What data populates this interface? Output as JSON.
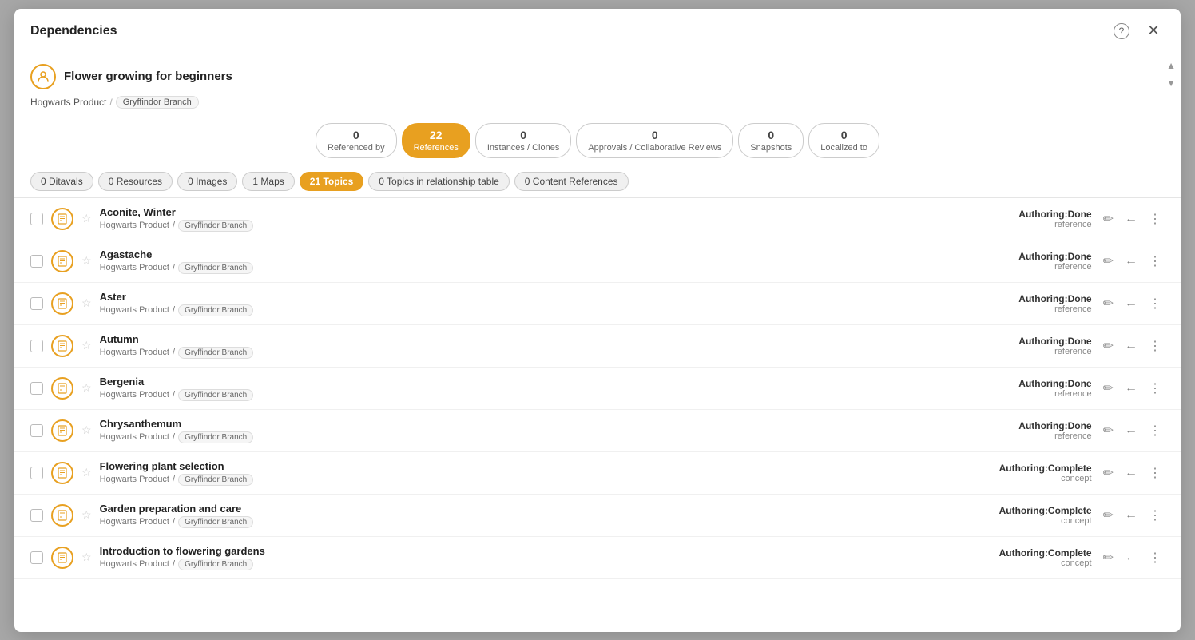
{
  "modal": {
    "title": "Dependencies",
    "close_label": "×",
    "help_icon": "?"
  },
  "item": {
    "name": "Flower growing for beginners",
    "icon": "person",
    "breadcrumb_product": "Hogwarts Product",
    "breadcrumb_sep": "/",
    "breadcrumb_branch": "Gryffindor Branch"
  },
  "tabs": [
    {
      "count": "0",
      "label": "Referenced by"
    },
    {
      "count": "22",
      "label": "References",
      "active": true
    },
    {
      "count": "0",
      "label": "Instances / Clones"
    },
    {
      "count": "0",
      "label": "Approvals / Collaborative Reviews"
    },
    {
      "count": "0",
      "label": "Snapshots"
    },
    {
      "count": "0",
      "label": "Localized to"
    }
  ],
  "chips": [
    {
      "label": "0 Ditavals"
    },
    {
      "label": "0 Resources"
    },
    {
      "label": "0 Images"
    },
    {
      "label": "1 Maps"
    },
    {
      "label": "21 Topics",
      "active": true
    },
    {
      "label": "0 Topics in relationship table"
    },
    {
      "label": "0 Content References"
    }
  ],
  "list_items": [
    {
      "title": "Aconite, Winter",
      "product": "Hogwarts Product",
      "branch": "Gryffindor Branch",
      "status": "Authoring:Done",
      "type": "reference"
    },
    {
      "title": "Agastache",
      "product": "Hogwarts Product",
      "branch": "Gryffindor Branch",
      "status": "Authoring:Done",
      "type": "reference"
    },
    {
      "title": "Aster",
      "product": "Hogwarts Product",
      "branch": "Gryffindor Branch",
      "status": "Authoring:Done",
      "type": "reference"
    },
    {
      "title": "Autumn",
      "product": "Hogwarts Product",
      "branch": "Gryffindor Branch",
      "status": "Authoring:Done",
      "type": "reference"
    },
    {
      "title": "Bergenia",
      "product": "Hogwarts Product",
      "branch": "Gryffindor Branch",
      "status": "Authoring:Done",
      "type": "reference"
    },
    {
      "title": "Chrysanthemum",
      "product": "Hogwarts Product",
      "branch": "Gryffindor Branch",
      "status": "Authoring:Done",
      "type": "reference"
    },
    {
      "title": "Flowering plant selection",
      "product": "Hogwarts Product",
      "branch": "Gryffindor Branch",
      "status": "Authoring:Complete",
      "type": "concept"
    },
    {
      "title": "Garden preparation and care",
      "product": "Hogwarts Product",
      "branch": "Gryffindor Branch",
      "status": "Authoring:Complete",
      "type": "concept"
    },
    {
      "title": "Introduction to flowering gardens",
      "product": "Hogwarts Product",
      "branch": "Gryffindor Branch",
      "status": "Authoring:Complete",
      "type": "concept"
    }
  ],
  "icons": {
    "edit": "✏",
    "back": "←",
    "more": "⋮",
    "star_empty": "☆",
    "doc": "≡",
    "scroll_up": "▲",
    "scroll_down": "▼"
  }
}
